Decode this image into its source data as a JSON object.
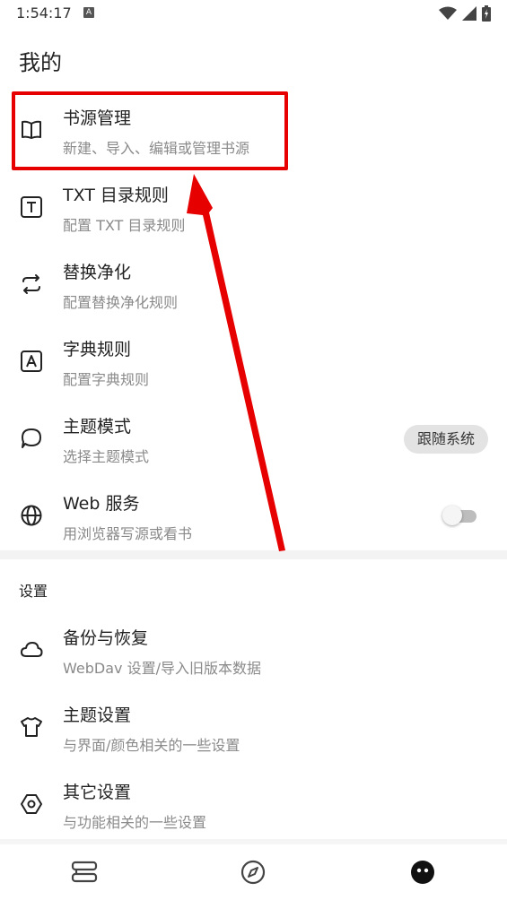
{
  "status_bar": {
    "time": "1:54:17",
    "notification_badge": "A"
  },
  "page": {
    "title": "我的"
  },
  "menu_items": [
    {
      "title": "书源管理",
      "subtitle": "新建、导入、编辑或管理书源",
      "icon": "book-open-icon"
    },
    {
      "title": "TXT 目录规则",
      "subtitle": "配置 TXT 目录规则",
      "icon": "txt-t-icon"
    },
    {
      "title": "替换净化",
      "subtitle": "配置替换净化规则",
      "icon": "swap-arrows-icon"
    },
    {
      "title": "字典规则",
      "subtitle": "配置字典规则",
      "icon": "dictionary-a-icon"
    },
    {
      "title": "主题模式",
      "subtitle": "选择主题模式",
      "icon": "theme-bubble-icon",
      "value": "跟随系统"
    },
    {
      "title": "Web 服务",
      "subtitle": "用浏览器写源或看书",
      "icon": "globe-icon",
      "toggle_on": false
    }
  ],
  "settings_section": {
    "header": "设置",
    "items": [
      {
        "title": "备份与恢复",
        "subtitle": "WebDav 设置/导入旧版本数据",
        "icon": "cloud-icon"
      },
      {
        "title": "主题设置",
        "subtitle": "与界面/颜色相关的一些设置",
        "icon": "tshirt-icon"
      },
      {
        "title": "其它设置",
        "subtitle": "与功能相关的一些设置",
        "icon": "hexagon-settings-icon"
      }
    ]
  },
  "bottom_nav": {
    "items": [
      "bookshelf-icon",
      "explore-compass-icon",
      "my-face-icon"
    ],
    "active_index": 2
  },
  "colors": {
    "annotation": "#e60000",
    "text_primary": "#222222",
    "text_secondary": "#8a8a8a"
  }
}
